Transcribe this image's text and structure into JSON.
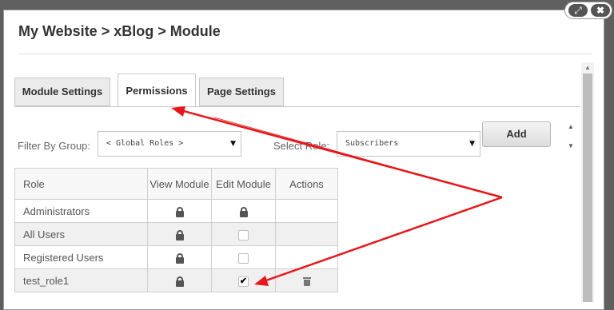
{
  "header": {
    "title": "My Website > xBlog > Module"
  },
  "window_controls": {
    "maximize_glyph": "⤢",
    "close_glyph": "✖"
  },
  "tabs": [
    {
      "label": "Module Settings",
      "active": false
    },
    {
      "label": "Permissions",
      "active": true
    },
    {
      "label": "Page Settings",
      "active": false
    }
  ],
  "filters": {
    "group_label": "Filter By Group:",
    "group_value": "< Global Roles >",
    "role_label": "Select Role:",
    "role_value": "Subscribers",
    "add_label": "Add"
  },
  "table": {
    "columns": [
      "Role",
      "View Module",
      "Edit Module",
      "Actions"
    ],
    "rows": [
      {
        "role": "Administrators",
        "view": "lock",
        "edit": "lock",
        "action": ""
      },
      {
        "role": "All Users",
        "view": "lock",
        "edit": "unchecked",
        "action": ""
      },
      {
        "role": "Registered Users",
        "view": "lock",
        "edit": "unchecked",
        "action": ""
      },
      {
        "role": "test_role1",
        "view": "lock",
        "edit": "checked",
        "action": "delete"
      }
    ]
  },
  "colors": {
    "annotation_arrow": "#e8161a",
    "annotation_line": "#e8161a"
  }
}
